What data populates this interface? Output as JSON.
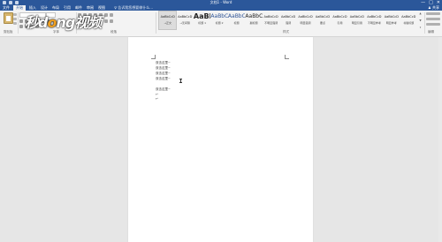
{
  "window": {
    "title": "文档1 - Word",
    "controls": [
      "—",
      "□",
      "✕"
    ]
  },
  "tabs": [
    {
      "label": "文件",
      "active": false
    },
    {
      "label": "开始",
      "active": true
    },
    {
      "label": "插入",
      "active": false
    },
    {
      "label": "设计",
      "active": false
    },
    {
      "label": "布局",
      "active": false
    },
    {
      "label": "引用",
      "active": false
    },
    {
      "label": "邮件",
      "active": false
    },
    {
      "label": "审阅",
      "active": false
    },
    {
      "label": "视图",
      "active": false
    }
  ],
  "tell_me": "♀ 告诉我您想要做什么...",
  "share": "♟ 共享",
  "ribbon": {
    "groups": [
      "剪贴板",
      "字体",
      "段落",
      "样式",
      "编辑"
    ],
    "styles": [
      {
        "preview": "AaBbCcD",
        "name": "→正文",
        "selected": true
      },
      {
        "preview": "AaBbCcD",
        "name": "→无间隔",
        "selected": false
      },
      {
        "preview": "AaBl",
        "name": "标题 1",
        "selected": false
      },
      {
        "preview": "AaBbC",
        "name": "标题 2",
        "selected": false
      },
      {
        "preview": "AaBbC",
        "name": "标题",
        "selected": false
      },
      {
        "preview": "AaBbC",
        "name": "副标题",
        "selected": false
      },
      {
        "preview": "AaBbCcD",
        "name": "不明显强调",
        "selected": false
      },
      {
        "preview": "AaBbCcD",
        "name": "强调",
        "selected": false
      },
      {
        "preview": "AaBbCcD",
        "name": "明显强调",
        "selected": false
      },
      {
        "preview": "AaBbCcD",
        "name": "要点",
        "selected": false
      },
      {
        "preview": "AaBbCcD",
        "name": "引用",
        "selected": false
      },
      {
        "preview": "AaBbCcD",
        "name": "明显引用",
        "selected": false
      },
      {
        "preview": "AaBbCcD",
        "name": "不明显参考",
        "selected": false
      },
      {
        "preview": "AaBbCcD",
        "name": "明显参考",
        "selected": false
      },
      {
        "preview": "AaBbCcD",
        "name": "书籍标题",
        "selected": false
      }
    ]
  },
  "document": {
    "lines": [
      "双击这里~",
      "双击这里~",
      "双击这里~",
      "双击这里~",
      "双击这里~",
      "↵",
      "↵"
    ]
  },
  "watermark": {
    "text_pre": "秒d",
    "text_o": "o",
    "text_post": "ng视频"
  },
  "colors": {
    "titlebar": "#2b579a",
    "ribbon": "#f3f3f3",
    "canvas": "#e6e6e6"
  }
}
